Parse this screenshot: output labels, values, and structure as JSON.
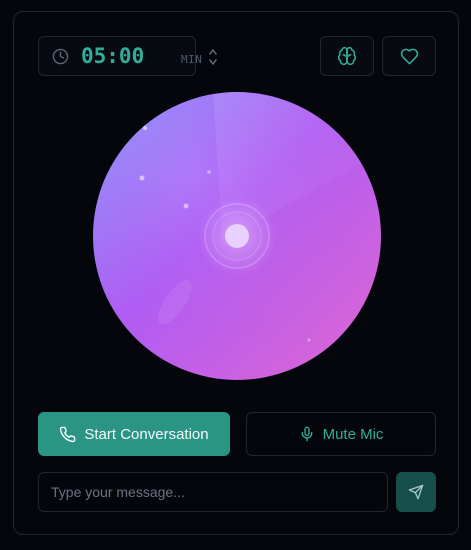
{
  "timer": {
    "value": "05:00",
    "unit": "MIN",
    "icon": "clock-icon",
    "stepper_icon": "chevron-up-down-icon"
  },
  "header_buttons": [
    {
      "icon": "brain-icon"
    },
    {
      "icon": "heart-icon"
    }
  ],
  "actions": {
    "start_label": "Start Conversation",
    "start_icon": "phone-icon",
    "mute_label": "Mute Mic",
    "mute_icon": "mic-icon"
  },
  "composer": {
    "placeholder": "Type your message...",
    "value": "",
    "send_icon": "send-icon"
  },
  "colors": {
    "background": "#04060c",
    "accent": "#2a9485",
    "accent_text": "#2fae99",
    "orb_start": "#8f8cff",
    "orb_mid": "#b65cf7",
    "orb_end": "#e06ad6"
  }
}
